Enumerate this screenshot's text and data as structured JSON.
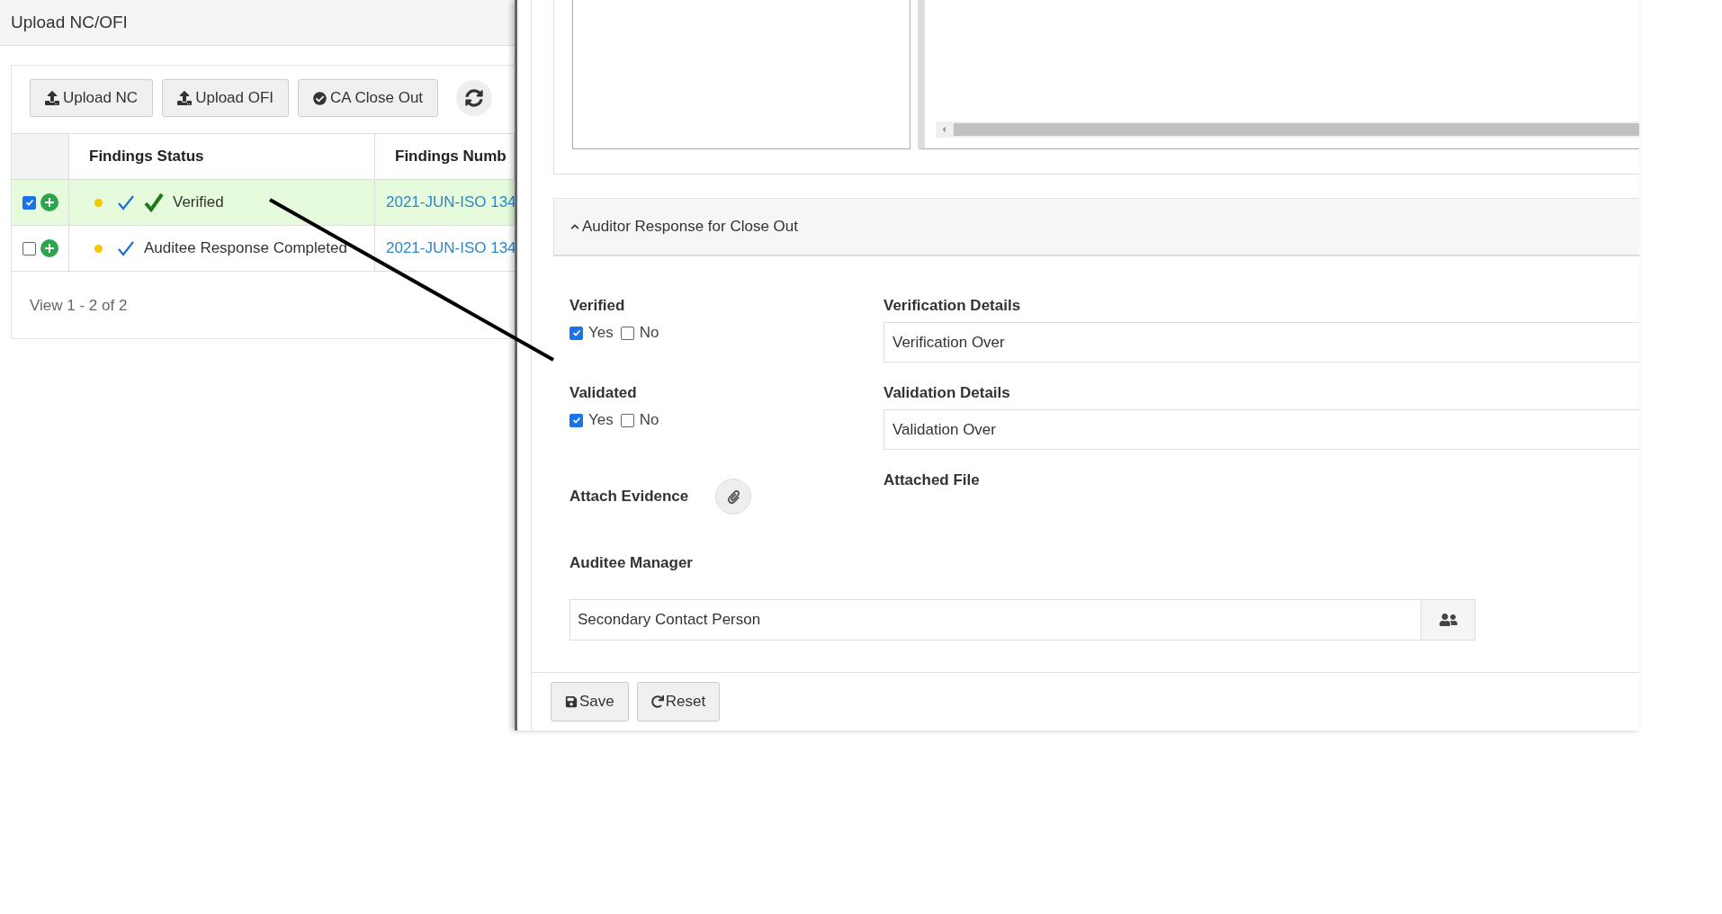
{
  "page_title": "Upload NC/OFI",
  "toolbar": {
    "buttons": [
      {
        "label": "Upload NC",
        "kind": "upload"
      },
      {
        "label": "Upload OFI",
        "kind": "upload"
      },
      {
        "label": "CA Close Out",
        "kind": "check"
      },
      {
        "kind": "refresh"
      }
    ]
  },
  "table": {
    "columns": [
      "Findings Status",
      "Findings Numb"
    ],
    "rows": [
      {
        "selected": true,
        "checked": true,
        "verified": true,
        "status": "Verified",
        "number": "2021-JUN-ISO 134"
      },
      {
        "selected": false,
        "checked": false,
        "verified": false,
        "status": "Auditee Response Completed",
        "number": "2021-JUN-ISO 134"
      }
    ],
    "pager": "View 1 - 2 of 2"
  },
  "section": {
    "title": "Auditor Response for Close Out",
    "expanded": true
  },
  "form": {
    "checks": [
      {
        "label": "Verified",
        "options": [
          {
            "label": "Yes",
            "checked": true
          },
          {
            "label": "No",
            "checked": false
          }
        ],
        "details_label": "Verification Details",
        "details_value": "Verification Over"
      },
      {
        "label": "Validated",
        "options": [
          {
            "label": "Yes",
            "checked": true
          },
          {
            "label": "No",
            "checked": false
          }
        ],
        "details_label": "Validation Details",
        "details_value": "Validation Over"
      }
    ],
    "attach_label": "Attach Evidence",
    "attached_label": "Attached File",
    "manager_label": "Auditee Manager",
    "manager_value": "Secondary Contact Person"
  },
  "actions": [
    {
      "label": "Save",
      "kind": "save"
    },
    {
      "label": "Reset",
      "kind": "reset"
    }
  ]
}
